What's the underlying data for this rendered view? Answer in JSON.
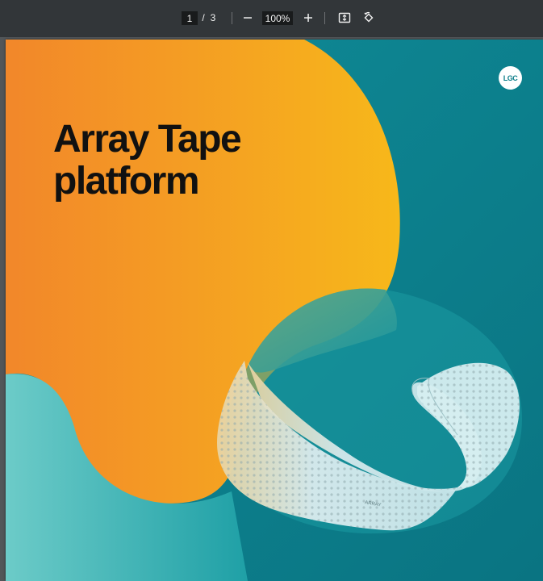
{
  "toolbar": {
    "page_current": "1",
    "page_separator": "/",
    "page_total": "3",
    "zoom_value": "100%",
    "zoom_out_icon": "minus-icon",
    "zoom_in_icon": "plus-icon",
    "fit_icon": "fit-to-page-icon",
    "rotate_icon": "rotate-icon"
  },
  "document": {
    "title_line1": "Array Tape",
    "title_line2": "platform",
    "logo_text": "LGC",
    "tape_label": "ARRAY"
  },
  "colors": {
    "toolbar_bg": "#323639",
    "viewer_bg": "#525659",
    "orange_start": "#f2872a",
    "orange_end": "#f7b51c",
    "teal": "#0e8590",
    "light_teal": "#64c7c5",
    "title_text": "#111111"
  }
}
